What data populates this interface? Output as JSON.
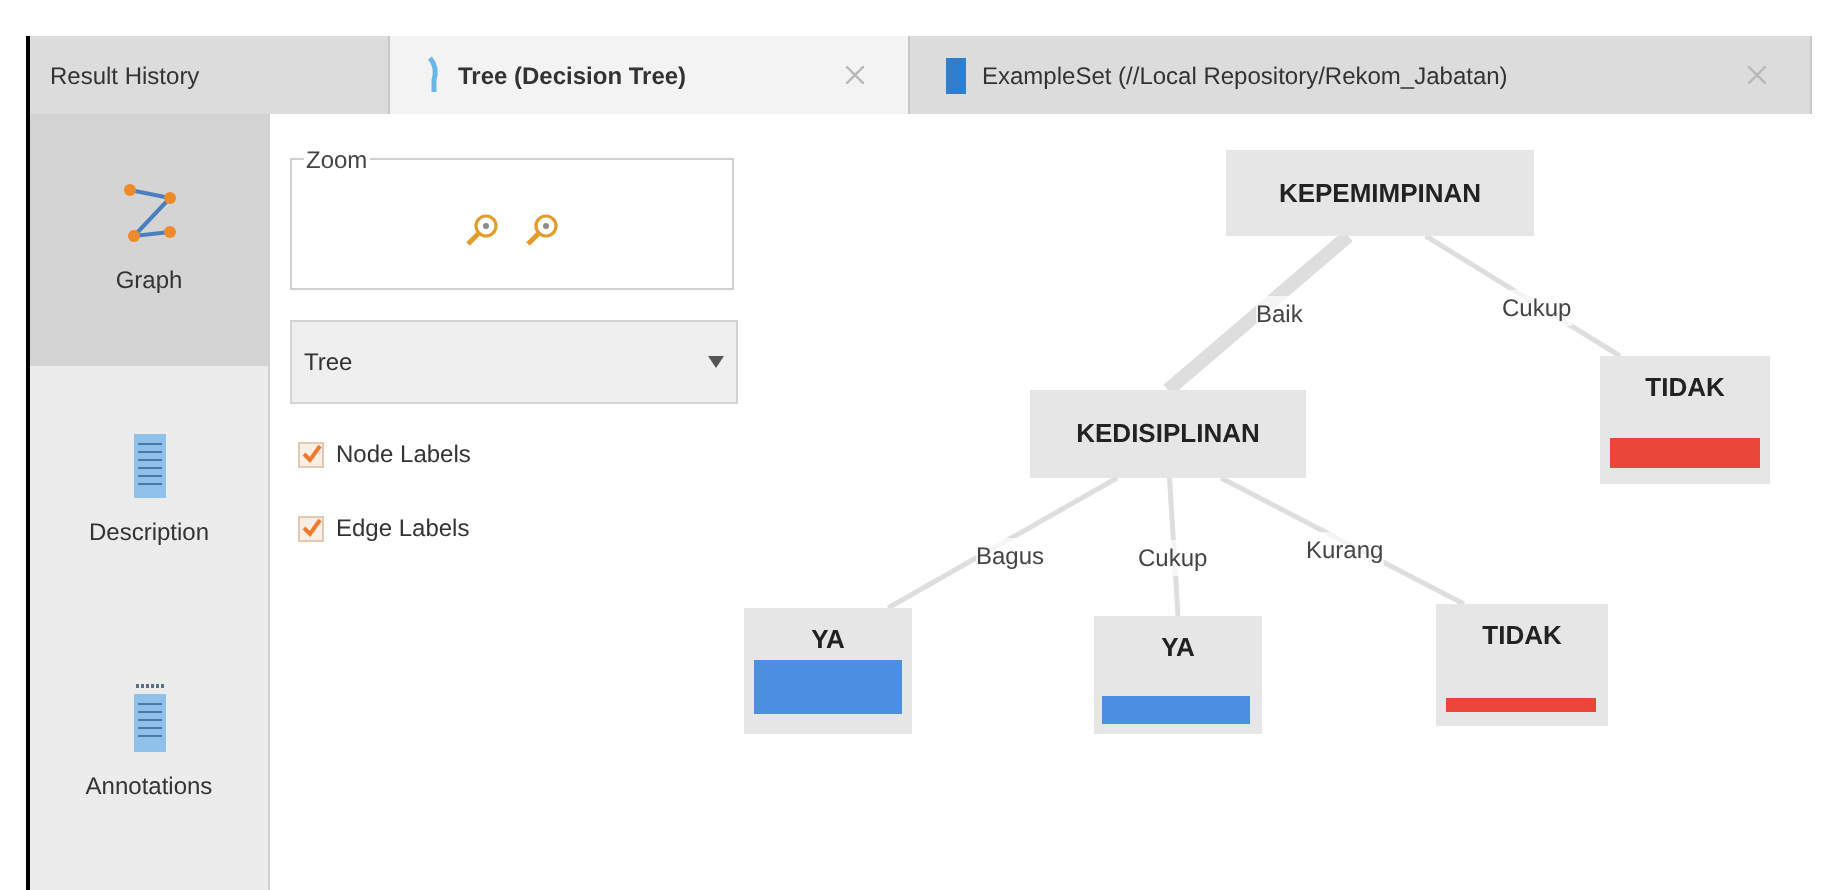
{
  "tabs": [
    {
      "label": "Result History",
      "kind": "plain",
      "selected": false,
      "closable": false
    },
    {
      "label": "Tree (Decision Tree)",
      "kind": "tree",
      "selected": true,
      "closable": true
    },
    {
      "label": "ExampleSet (//Local Repository/Rekom_Jabatan)",
      "kind": "data",
      "selected": false,
      "closable": true
    }
  ],
  "sidebar": {
    "items": [
      {
        "label": "Graph",
        "kind": "graph",
        "selected": true
      },
      {
        "label": "Description",
        "kind": "description",
        "selected": false
      },
      {
        "label": "Annotations",
        "kind": "annotations",
        "selected": false
      }
    ]
  },
  "zoom_panel": {
    "title": "Zoom"
  },
  "layout_dropdown": {
    "value": "Tree"
  },
  "options": [
    {
      "label": "Node Labels",
      "checked": true
    },
    {
      "label": "Edge Labels",
      "checked": true
    }
  ],
  "tree": {
    "label": "KEPEMIMPINAN",
    "children": [
      {
        "edge": "Baik",
        "label": "KEDISIPLINAN",
        "children": [
          {
            "edge": "Bagus",
            "label": "YA",
            "color": "#4a8fe0"
          },
          {
            "edge": "Cukup",
            "label": "YA",
            "color": "#4a8fe0"
          },
          {
            "edge": "Kurang",
            "label": "TIDAK",
            "color": "#e8473a"
          }
        ]
      },
      {
        "edge": "Cukup",
        "label": "TIDAK",
        "color": "#e8473a"
      }
    ]
  }
}
